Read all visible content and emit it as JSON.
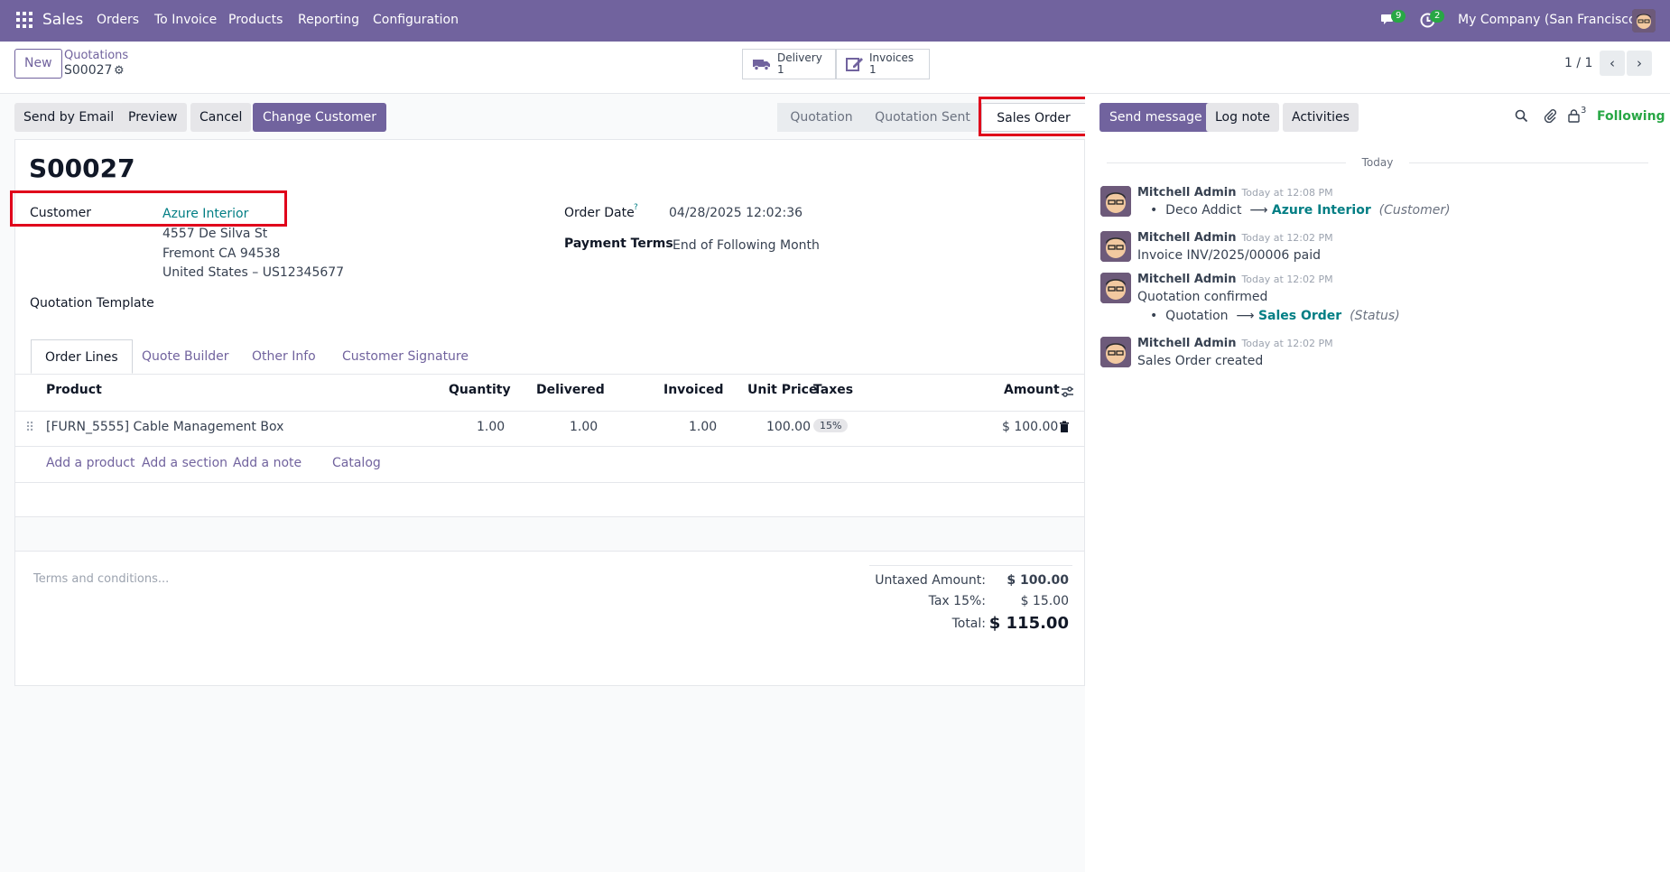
{
  "navbar": {
    "app": "Sales",
    "menu": [
      "Orders",
      "To Invoice",
      "Products",
      "Reporting",
      "Configuration"
    ],
    "messages_count": "9",
    "activities_count": "2",
    "company": "My Company (San Francisco)"
  },
  "control": {
    "new_label": "New",
    "breadcrumb_parent": "Quotations",
    "breadcrumb_current": "S00027",
    "delivery_label": "Delivery",
    "delivery_count": "1",
    "invoices_label": "Invoices",
    "invoices_count": "1",
    "pager": "1 / 1"
  },
  "actions": {
    "send_email": "Send by Email",
    "preview": "Preview",
    "cancel": "Cancel",
    "change_customer": "Change Customer"
  },
  "statusbar": [
    "Quotation",
    "Quotation Sent",
    "Sales Order"
  ],
  "chatter_actions": {
    "send_message": "Send message",
    "log_note": "Log note",
    "activities": "Activities",
    "followers_count": "3",
    "following": "Following"
  },
  "form": {
    "title": "S00027",
    "customer_label": "Customer",
    "customer_name": "Azure Interior",
    "address1": "4557 De Silva St",
    "address2": "Fremont CA 94538",
    "address3": "United States – US12345677",
    "template_label": "Quotation Template",
    "order_date_label": "Order Date",
    "order_date_help": "?",
    "order_date": "04/28/2025 12:02:36",
    "payment_terms_label": "Payment Terms",
    "payment_terms": "End of Following Month"
  },
  "tabs": [
    "Order Lines",
    "Quote Builder",
    "Other Info",
    "Customer Signature"
  ],
  "table": {
    "headers": {
      "product": "Product",
      "quantity": "Quantity",
      "delivered": "Delivered",
      "invoiced": "Invoiced",
      "unit_price": "Unit Price",
      "taxes": "Taxes",
      "amount": "Amount"
    },
    "rows": [
      {
        "product": "[FURN_5555] Cable Management Box",
        "quantity": "1.00",
        "delivered": "1.00",
        "invoiced": "1.00",
        "unit_price": "100.00",
        "tax": "15%",
        "amount": "$ 100.00"
      }
    ],
    "add_product": "Add a product",
    "add_section": "Add a section",
    "add_note": "Add a note",
    "catalog": "Catalog"
  },
  "terms_placeholder": "Terms and conditions...",
  "totals": {
    "untaxed_label": "Untaxed Amount:",
    "untaxed": "$ 100.00",
    "tax_label": "Tax 15%:",
    "tax": "$ 15.00",
    "total_label": "Total:",
    "total": "$ 115.00"
  },
  "chatter": {
    "today": "Today",
    "messages": [
      {
        "author": "Mitchell Admin",
        "time": "Today at 12:08 PM",
        "old": "Deco Addict",
        "arrow": "⟶",
        "new": "Azure Interior",
        "field": "(Customer)"
      },
      {
        "author": "Mitchell Admin",
        "time": "Today at 12:02 PM",
        "body": "Invoice INV/2025/00006 paid"
      },
      {
        "author": "Mitchell Admin",
        "time": "Today at 12:02 PM",
        "body": "Quotation confirmed",
        "old": "Quotation",
        "arrow": "⟶",
        "new": "Sales Order",
        "field": "(Status)"
      },
      {
        "author": "Mitchell Admin",
        "time": "Today at 12:02 PM",
        "body": "Sales Order created"
      }
    ]
  }
}
